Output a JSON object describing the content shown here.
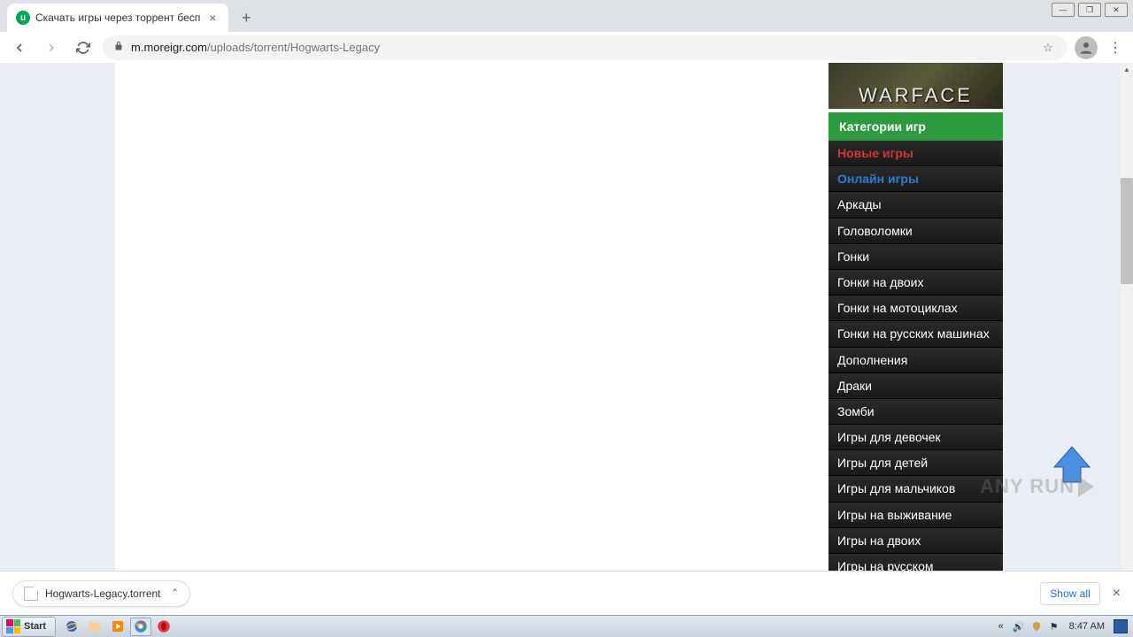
{
  "browser": {
    "tab_title": "Скачать игры через торрент бесп",
    "url_host": "m.moreigr.com",
    "url_path": "/uploads/torrent/Hogwarts-Legacy"
  },
  "page": {
    "banner_text": "WARFACE",
    "categories_header": "Категории игр",
    "categories": [
      {
        "label": "Новые игры",
        "style": "red"
      },
      {
        "label": "Онлайн игры",
        "style": "blue"
      },
      {
        "label": "Аркады",
        "style": ""
      },
      {
        "label": "Головоломки",
        "style": ""
      },
      {
        "label": "Гонки",
        "style": ""
      },
      {
        "label": "Гонки на двоих",
        "style": ""
      },
      {
        "label": "Гонки на мотоциклах",
        "style": ""
      },
      {
        "label": "Гонки на русских машинах",
        "style": ""
      },
      {
        "label": "Дополнения",
        "style": ""
      },
      {
        "label": "Драки",
        "style": ""
      },
      {
        "label": "Зомби",
        "style": ""
      },
      {
        "label": "Игры для девочек",
        "style": ""
      },
      {
        "label": "Игры для детей",
        "style": ""
      },
      {
        "label": "Игры для мальчиков",
        "style": ""
      },
      {
        "label": "Игры на выживание",
        "style": ""
      },
      {
        "label": "Игры на двоих",
        "style": ""
      },
      {
        "label": "Игры на русском",
        "style": ""
      }
    ]
  },
  "download": {
    "filename": "Hogwarts-Legacy.torrent",
    "show_all": "Show all"
  },
  "taskbar": {
    "start": "Start",
    "clock": "8:47 AM"
  },
  "watermark": "ANY    RUN"
}
